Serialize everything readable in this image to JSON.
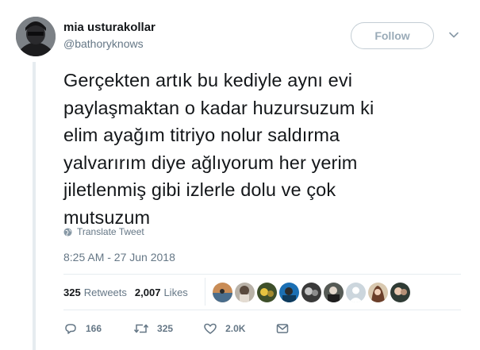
{
  "user": {
    "display_name": "mia usturakollar",
    "handle": "@bathoryknows"
  },
  "follow_button_label": "Follow",
  "tweet": {
    "lines": [
      "Gerçekten artık bu kediyle aynı evi",
      "paylaşmaktan o kadar huzursuzum ki",
      "elim ayağım titriyo nolur saldırma",
      "yalvarırım diye ağlıyorum her yerim",
      "jiletlenmiş gibi izlerle dolu ve çok",
      "mutsuzum"
    ],
    "translate_label": "Translate Tweet",
    "timestamp": "8:25 AM - 27 Jun 2018"
  },
  "stats": {
    "retweets_count": "325",
    "retweets_label": "Retweets",
    "likes_count": "2,007",
    "likes_label": "Likes"
  },
  "actions": {
    "replies": "166",
    "retweets": "325",
    "likes": "2.0K"
  },
  "colors": {
    "text": "#14171a",
    "muted": "#657786",
    "border": "#e6ecf0",
    "follow_border": "#c3cdd4"
  },
  "icons": [
    "chevron-down-icon",
    "globe-icon",
    "reply-icon",
    "retweet-icon",
    "heart-icon",
    "direct-message-icon"
  ]
}
